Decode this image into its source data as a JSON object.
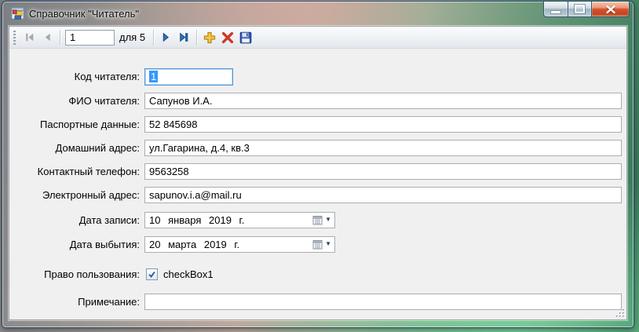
{
  "window": {
    "title": "Справочник \"Читатель\""
  },
  "toolbar": {
    "position_value": "1",
    "count_label": "для 5",
    "buttons": [
      "move-first",
      "move-previous",
      "position",
      "count-of",
      "move-next",
      "move-last",
      "add-new",
      "delete",
      "save"
    ]
  },
  "form": {
    "rows": [
      {
        "label": "Код читателя:",
        "value": "1"
      },
      {
        "label": "ФИО читателя:",
        "value": "Сапунов И.А."
      },
      {
        "label": "Паспортные данные:",
        "value": "52 845698"
      },
      {
        "label": "Домашний адрес:",
        "value": "ул.Гагарина, д.4, кв.3"
      },
      {
        "label": "Контактный телефон:",
        "value": "9563258"
      },
      {
        "label": "Электронный адрес:",
        "value": "sapunov.i.a@mail.ru"
      },
      {
        "label": "Дата записи:",
        "value": "10 января 2019 г."
      },
      {
        "label": "Дата выбытия:",
        "value": "20 марта 2019 г."
      },
      {
        "label": "Право пользования:",
        "value": "checkBox1",
        "checked": true
      },
      {
        "label": "Примечание:",
        "value": ""
      }
    ]
  },
  "icons": {
    "date_dropdown_arrow": "▼"
  },
  "colors": {
    "frame_blue": "#30659f",
    "selection_blue": "#3399ff",
    "focus_border": "#4f96d8",
    "close_red": "#c04a28",
    "add_gold": "#f6c944",
    "delete_red": "#cd3728",
    "save_blue": "#2e55b5",
    "client_bg": "#f0f0f0"
  }
}
